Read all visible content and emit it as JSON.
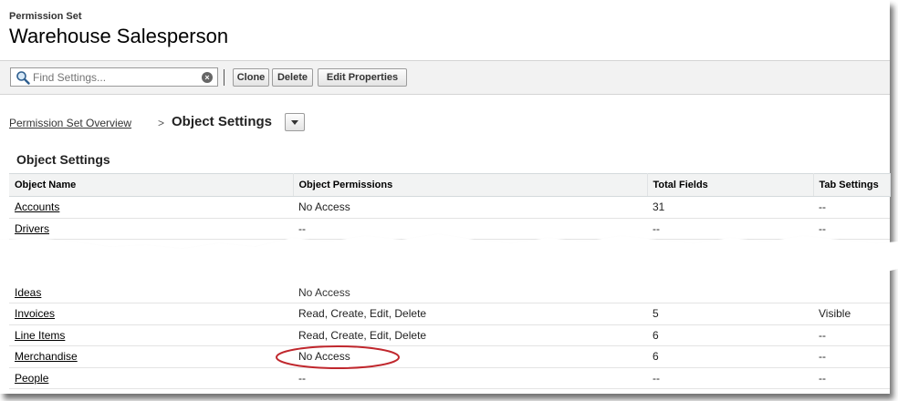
{
  "header": {
    "label": "Permission Set",
    "title": "Warehouse Salesperson"
  },
  "toolbar": {
    "search_placeholder": "Find Settings...",
    "clone_label": "Clone",
    "delete_label": "Delete",
    "edit_label": "Edit Properties"
  },
  "breadcrumb": {
    "link": "Permission Set Overview",
    "separator": ">",
    "current": "Object Settings"
  },
  "section_title": "Object Settings",
  "table": {
    "columns": [
      "Object Name",
      "Object Permissions",
      "Total Fields",
      "Tab Settings"
    ],
    "rows": [
      {
        "name": "Accounts",
        "permissions": "No Access",
        "fields": "31",
        "tab": "--"
      },
      {
        "name": "Drivers",
        "permissions": "--",
        "fields": "--",
        "tab": "--"
      },
      {
        "name": "Ideas",
        "permissions": "No Access",
        "fields": "",
        "tab": ""
      },
      {
        "name": "Invoices",
        "permissions": "Read, Create, Edit, Delete",
        "fields": "5",
        "tab": "Visible"
      },
      {
        "name": "Line Items",
        "permissions": "Read, Create, Edit, Delete",
        "fields": "6",
        "tab": "--"
      },
      {
        "name": "Merchandise",
        "permissions": "No Access",
        "fields": "6",
        "tab": "--"
      },
      {
        "name": "People",
        "permissions": "--",
        "fields": "--",
        "tab": "--"
      }
    ]
  },
  "colors": {
    "highlight_oval": "#c0272d",
    "header_bg": "#f2f3f3"
  },
  "icons": [
    "search-icon",
    "clear-icon",
    "chevron-down-icon"
  ]
}
